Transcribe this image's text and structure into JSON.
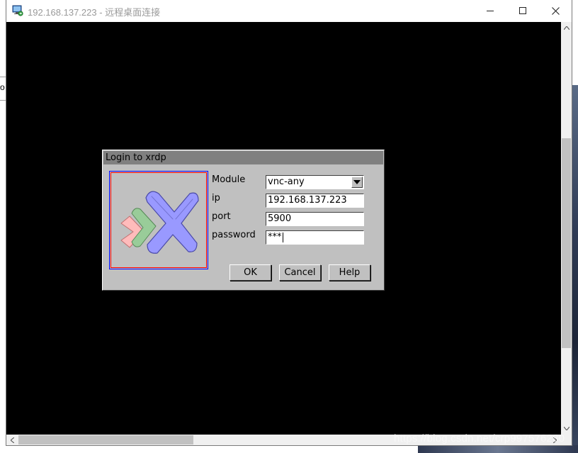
{
  "window": {
    "title": "192.168.137.223 - 远程桌面连接",
    "icons": {
      "app": "remote-desktop-icon",
      "minimize": "minimize-icon",
      "maximize": "maximize-icon",
      "close": "close-icon"
    }
  },
  "background": {
    "left_fragment": "o"
  },
  "dialog": {
    "title": "Login to xrdp",
    "fields": {
      "module": {
        "label": "Module",
        "value": "vnc-any"
      },
      "ip": {
        "label": "ip",
        "value": "192.168.137.223"
      },
      "port": {
        "label": "port",
        "value": "5900"
      },
      "password": {
        "label": "password",
        "value": "***"
      }
    },
    "buttons": {
      "ok": "OK",
      "cancel": "Cancel",
      "help": "Help"
    },
    "logo_icon": "xrdp-logo"
  },
  "watermark": "https://blog.csdn.net/crp997576280",
  "colors": {
    "remote_bg": "#000000",
    "dialog_bg": "#c0c0c0",
    "dialog_title_bg": "#808080",
    "logo_blue": "#9999ff",
    "logo_green": "#99cc99",
    "logo_pink": "#ffbbbb"
  }
}
